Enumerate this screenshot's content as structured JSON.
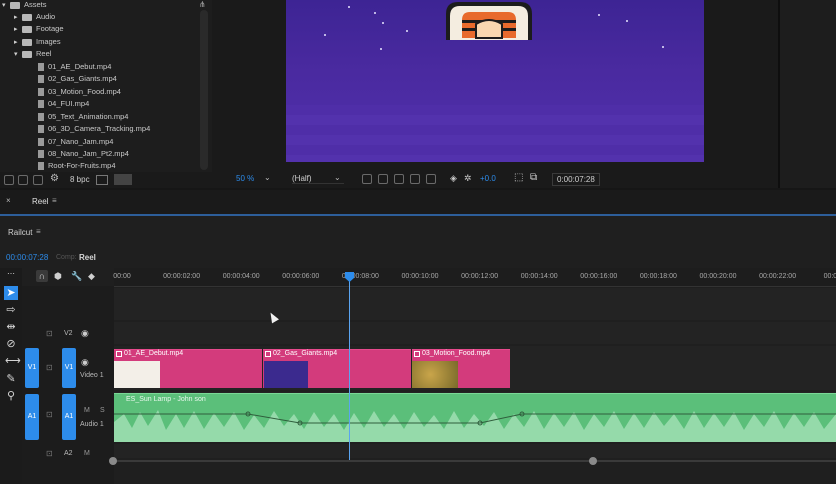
{
  "project": {
    "root_label": "Assets",
    "folders": [
      {
        "label": "Audio"
      },
      {
        "label": "Footage"
      },
      {
        "label": "Images"
      },
      {
        "label": "Reel"
      }
    ],
    "files": [
      "01_AE_Debut.mp4",
      "02_Gas_Giants.mp4",
      "03_Motion_Food.mp4",
      "04_FUI.mp4",
      "05_Text_Animation.mp4",
      "06_3D_Camera_Tracking.mp4",
      "07_Nano_Jam.mp4",
      "08_Nano_Jam_Pt2.mp4",
      "Root-For-Fruits.mp4"
    ],
    "bpc_label": "8 bpc"
  },
  "viewer": {
    "zoom": "50 %",
    "resolution": "(Half)",
    "exposure": "+0.0",
    "timecode": "0:00:07:28"
  },
  "comp_tab": {
    "label": "Reel"
  },
  "timeline": {
    "panel_title": "Railcut",
    "current_time": "00:00:07:28",
    "comp_prefix": "Comp:",
    "comp_name": "Reel",
    "ruler_labels": [
      "00:00",
      "00:00:02:00",
      "00:00:04:00",
      "00:00:06:00",
      "00:00:08:00",
      "00:00:10:00",
      "00:00:12:00",
      "00:00:14:00",
      "00:00:16:00",
      "00:00:18:00",
      "00:00:20:00",
      "00:00:22:00",
      "00:00:24"
    ],
    "tracks": {
      "v2": "V2",
      "v1": "V1",
      "video1": "Video 1",
      "a1": "A1",
      "audio1": "Audio 1",
      "a2": "A2"
    },
    "clips": [
      {
        "label": "01_AE_Debut.mp4"
      },
      {
        "label": "02_Gas_Giants.mp4"
      },
      {
        "label": "03_Motion_Food.mp4"
      }
    ],
    "audio_clip": {
      "label": "ES_Sun Lamp - John son"
    },
    "track_button_label_m": "M",
    "track_button_label_s": "S"
  },
  "colors": {
    "accent_blue": "#2d8ceb",
    "clip_pink": "#d33b7c",
    "audio_green": "#5bbf7a",
    "sky_purple": "#4a2aa0"
  }
}
